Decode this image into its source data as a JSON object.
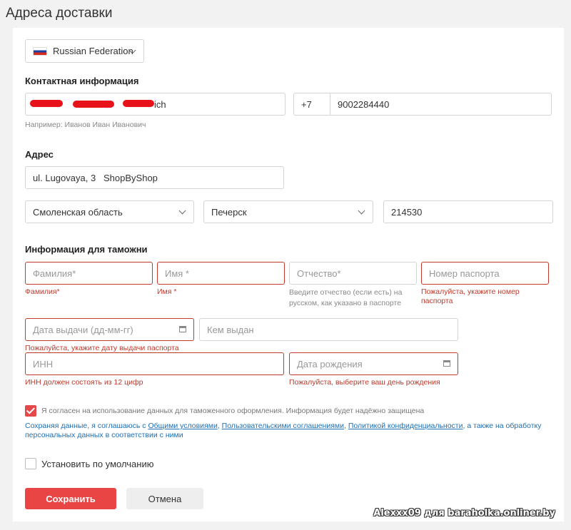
{
  "page": {
    "title": "Адреса доставки"
  },
  "country": {
    "name": "Russian Federation"
  },
  "contact": {
    "heading": "Контактная информация",
    "name_value": "ich",
    "name_hint": "Например: Иванов Иван Иванович",
    "phone_code": "+7",
    "phone_number": "9002284440"
  },
  "address": {
    "heading": "Адрес",
    "street": "ul. Lugovaya, 3   ShopByShop",
    "region": "Смоленская область",
    "city": "Печерск",
    "zip": "214530"
  },
  "customs": {
    "heading": "Информация для таможни",
    "lastname": {
      "placeholder": "Фамилия*",
      "error": "Фамилия*"
    },
    "firstname": {
      "placeholder": "Имя *",
      "error": "Имя *"
    },
    "patronymic": {
      "placeholder": "Отчество*",
      "hint": "Введите отчество (если есть) на русском, как указано в паспорте"
    },
    "passport": {
      "placeholder": "Номер паспорта",
      "error": "Пожалуйста, укажите номер паспорта"
    },
    "issue_date": {
      "placeholder": "Дата выдачи (дд-мм-гг)",
      "error": "Пожалуйста, укажите дату выдачи паспорта"
    },
    "issued_by": {
      "placeholder": "Кем выдан"
    },
    "inn": {
      "placeholder": "ИНН",
      "error": "ИНН должен состоять из 12 цифр"
    },
    "birth_date": {
      "placeholder": "Дата рождения",
      "error": "Пожалуйста, выберите ваш день рождения"
    }
  },
  "consent": {
    "checked": true,
    "text": "Я согласен на использование данных для таможенного оформления. Информация будет надёжно защищена",
    "sub_prefix": "Сохраняя данные, я соглашаюсь с ",
    "link1": "Общими условиями",
    "sep1": ", ",
    "link2": "Пользовательскими соглашениями",
    "sep2": ", ",
    "link3": "Политикой конфиденциальности",
    "sub_suffix": ", а также на обработку персональных данных в соответствии с ними"
  },
  "default_address": {
    "label": "Установить по умолчанию",
    "checked": false
  },
  "buttons": {
    "save": "Сохранить",
    "cancel": "Отмена"
  },
  "watermark": "Alexxx09 для baraholka.onliner.by",
  "colors": {
    "accent": "#e94545",
    "error": "#c0392b",
    "link": "#1f6fb2"
  },
  "icons": {
    "flag": "russia-flag-icon",
    "chevron": "chevron-down-icon",
    "calendar": "calendar-icon",
    "check": "check-icon"
  }
}
